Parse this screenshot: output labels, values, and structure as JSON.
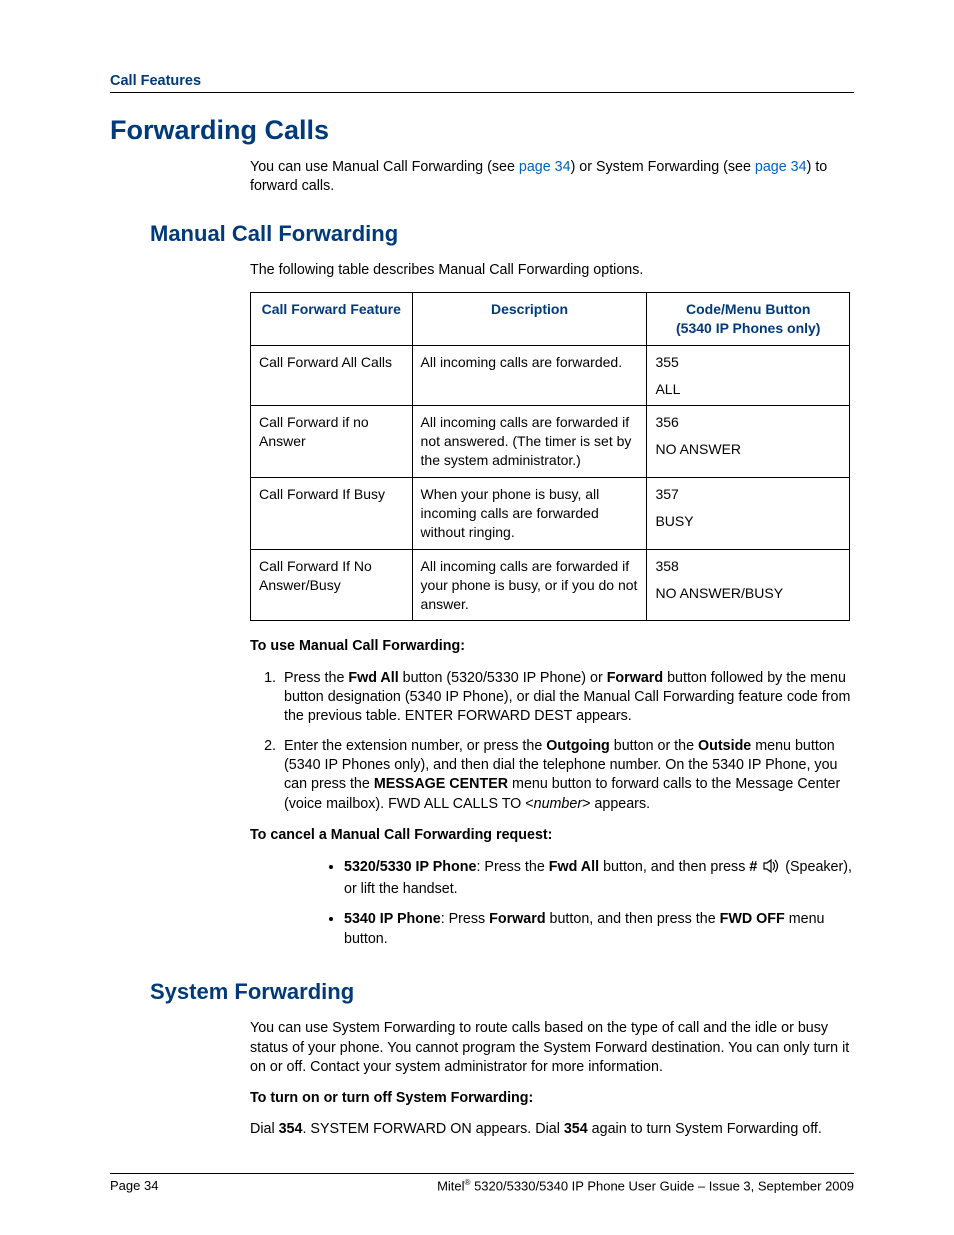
{
  "header": {
    "section": "Call Features"
  },
  "h1": "Forwarding Calls",
  "intro": {
    "pre": "You can use Manual Call Forwarding (see ",
    "link1": "page 34",
    "mid": ") or System Forwarding (see ",
    "link2": "page 34",
    "post": ") to forward calls."
  },
  "manual": {
    "title": "Manual Call Forwarding",
    "lead": "The following table describes Manual Call Forwarding options.",
    "table": {
      "headers": {
        "c1": "Call Forward Feature",
        "c2": "Description",
        "c3a": "Code/Menu Button",
        "c3b": "(5340 IP Phones only)"
      },
      "rows": [
        {
          "feature": "Call Forward All Calls",
          "desc": "All incoming calls are forwarded.",
          "code": "355",
          "menu": "ALL"
        },
        {
          "feature": "Call Forward if no Answer",
          "desc": "All incoming calls are forwarded if not answered. (The timer is set by the system administrator.)",
          "code": "356",
          "menu": "NO ANSWER"
        },
        {
          "feature": "Call Forward If Busy",
          "desc": "When your phone is busy, all incoming calls are forwarded without ringing.",
          "code": "357",
          "menu": "BUSY"
        },
        {
          "feature": "Call Forward If No Answer/Busy",
          "desc": "All incoming calls are forwarded if your phone is busy, or if you do not answer.",
          "code": "358",
          "menu": "NO ANSWER/BUSY"
        }
      ]
    },
    "use_heading": "To use Manual Call Forwarding:",
    "step1": {
      "a": "Press the ",
      "b": "Fwd All",
      "c": " button (5320/5330 IP Phone) or ",
      "d": "Forward",
      "e": " button followed by the menu button designation (5340 IP Phone), or dial the Manual Call Forwarding feature code from the previous table. ENTER FORWARD DEST appears."
    },
    "step2": {
      "a": "Enter the extension number, or press the ",
      "b": "Outgoing",
      "c": " button or the ",
      "d": "Outside",
      "e": " menu button (5340 IP Phones only), and then dial the telephone number. On the 5340 IP Phone, you can press the ",
      "f": "MESSAGE CENTER",
      "g": " menu button to forward calls to the Message Center (voice mailbox). FWD ALL CALLS TO <",
      "h": "number",
      "i": "> appears."
    },
    "cancel_heading": "To cancel a Manual Call Forwarding request:",
    "cancel1": {
      "a": "5320/5330 IP Phone",
      "b": ": Press the ",
      "c": "Fwd All",
      "d": " button, and then press ",
      "e": "#",
      "f": " (Speaker), or lift the handset."
    },
    "cancel2": {
      "a": "5340 IP Phone",
      "b": ": Press ",
      "c": "Forward",
      "d": " button, and then press the ",
      "e": "FWD OFF",
      "f": " menu button."
    }
  },
  "system": {
    "title": "System Forwarding",
    "para": "You can use System Forwarding to route calls based on the type of call and the idle or busy status of your phone. You cannot program the System Forward destination. You can only turn it on or off. Contact your system administrator for more information.",
    "turn_heading": "To turn on or turn off System Forwarding:",
    "dial": {
      "a": "Dial ",
      "b": "354",
      "c": ". SYSTEM FORWARD ON appears. Dial ",
      "d": "354",
      "e": " again to turn System Forwarding off."
    }
  },
  "footer": {
    "left": "Page 34",
    "right_a": "Mitel",
    "right_b": " 5320/5330/5340 IP Phone User Guide  – Issue 3, September 2009"
  }
}
